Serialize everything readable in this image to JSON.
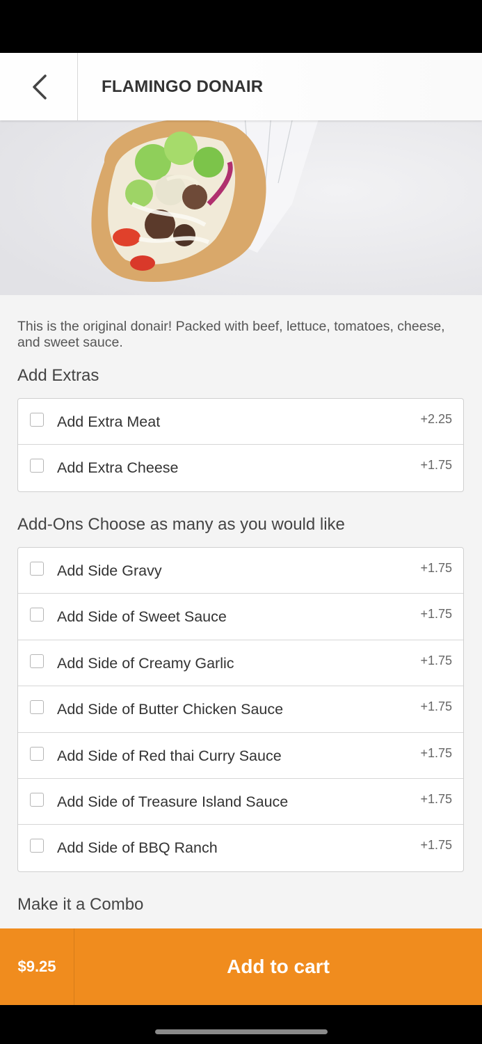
{
  "header": {
    "title": "FLAMINGO DONAIR"
  },
  "item": {
    "description": "This is the original donair! Packed with beef, lettuce, tomatoes, cheese, and sweet sauce."
  },
  "extras": {
    "title": "Add Extras",
    "options": [
      {
        "label": "Add Extra Meat",
        "price": "+2.25",
        "checked": false
      },
      {
        "label": "Add Extra Cheese",
        "price": "+1.75",
        "checked": false
      }
    ]
  },
  "addons": {
    "title": "Add-Ons Choose as many as you would like",
    "options": [
      {
        "label": "Add Side Gravy",
        "price": "+1.75",
        "checked": false
      },
      {
        "label": "Add Side of Sweet Sauce",
        "price": "+1.75",
        "checked": false
      },
      {
        "label": "Add Side of Creamy Garlic",
        "price": "+1.75",
        "checked": false
      },
      {
        "label": "Add Side of Butter Chicken Sauce",
        "price": "+1.75",
        "checked": false
      },
      {
        "label": "Add Side of Red thai Curry Sauce",
        "price": "+1.75",
        "checked": false
      },
      {
        "label": "Add Side of Treasure Island Sauce",
        "price": "+1.75",
        "checked": false
      },
      {
        "label": "Add Side of BBQ Ranch",
        "price": "+1.75",
        "checked": false
      }
    ]
  },
  "combo": {
    "title": "Make it a Combo"
  },
  "footer": {
    "price": "$9.25",
    "button_label": "Add to cart"
  },
  "colors": {
    "accent": "#f08c1e",
    "background": "#f4f4f4"
  },
  "icons": {
    "back": "chevron-left-icon"
  }
}
